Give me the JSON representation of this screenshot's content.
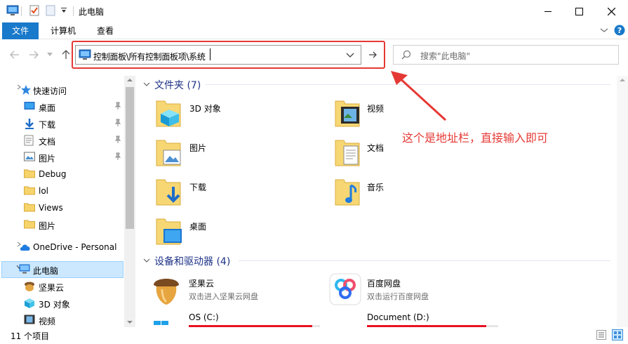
{
  "window": {
    "title": "此电脑",
    "minimize": "minimize",
    "maximize": "maximize",
    "close": "close"
  },
  "ribbon": {
    "tabs": [
      "文件",
      "计算机",
      "查看"
    ]
  },
  "address": {
    "path": "控制面板\\所有控制面板项\\系统",
    "search_placeholder": "搜索\"此电脑\""
  },
  "nav": {
    "items": [
      {
        "label": "快速访问",
        "icon": "star-icon"
      },
      {
        "label": "桌面",
        "icon": "desktop-icon",
        "pinned": true
      },
      {
        "label": "下载",
        "icon": "download-icon",
        "pinned": true
      },
      {
        "label": "文档",
        "icon": "document-icon",
        "pinned": true
      },
      {
        "label": "图片",
        "icon": "picture-icon",
        "pinned": true
      },
      {
        "label": "Debug",
        "icon": "folder-icon"
      },
      {
        "label": "lol",
        "icon": "folder-icon"
      },
      {
        "label": "Views",
        "icon": "folder-icon"
      },
      {
        "label": "图片",
        "icon": "folder-icon"
      },
      {
        "label": "OneDrive - Personal",
        "icon": "cloud-icon"
      },
      {
        "label": "此电脑",
        "icon": "computer-icon",
        "selected": true
      },
      {
        "label": "坚果云",
        "icon": "nut-icon"
      },
      {
        "label": "3D 对象",
        "icon": "cube-icon"
      },
      {
        "label": "视频",
        "icon": "video-icon"
      }
    ]
  },
  "folders": {
    "header": "文件夹 (7)",
    "items": [
      "3D 对象",
      "视频",
      "图片",
      "文档",
      "下载",
      "音乐",
      "桌面"
    ]
  },
  "drives": {
    "header": "设备和驱动器 (4)",
    "items": [
      {
        "name": "坚果云",
        "sub": "双击进入坚果云网盘"
      },
      {
        "name": "百度网盘",
        "sub": "双击运行百度网盘"
      },
      {
        "name": "OS (C:)",
        "sub": ""
      },
      {
        "name": "Document (D:)",
        "sub": ""
      }
    ]
  },
  "annotation": "这个是地址栏，直接输入即可",
  "status": {
    "count": "11 个项目"
  },
  "colors": {
    "accent": "#1979ca",
    "highlight": "#e53935",
    "selection": "#cce8ff"
  }
}
